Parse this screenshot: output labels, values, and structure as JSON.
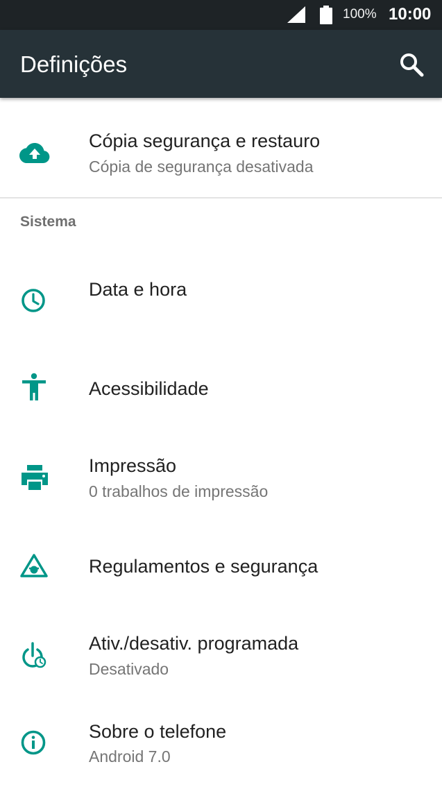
{
  "status_bar": {
    "battery_percent": "100%",
    "time": "10:00",
    "icons": [
      "signal-icon",
      "battery-icon"
    ]
  },
  "app_bar": {
    "title": "Definições",
    "action_icon": "search-icon"
  },
  "accent_color": "#009688",
  "top_item": {
    "icon": "cloud-upload-icon",
    "title": "Cópia segurança e restauro",
    "subtitle": "Cópia de segurança desativada"
  },
  "section_header": "Sistema",
  "items": [
    {
      "icon": "clock-icon",
      "title": "Data e hora"
    },
    {
      "icon": "accessibility-icon",
      "title": "Acessibilidade"
    },
    {
      "icon": "printer-icon",
      "title": "Impressão",
      "subtitle": "0 trabalhos de impressão"
    },
    {
      "icon": "regulatory-icon",
      "title": "Regulamentos e segurança"
    },
    {
      "icon": "scheduled-power-icon",
      "title": "Ativ./desativ. programada",
      "subtitle": "Desativado"
    },
    {
      "icon": "info-icon",
      "title": "Sobre o telefone",
      "subtitle": "Android 7.0"
    }
  ]
}
